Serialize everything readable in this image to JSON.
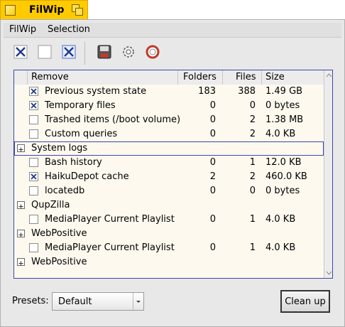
{
  "window": {
    "title": "FilWip"
  },
  "menu": [
    "FilWip",
    "Selection"
  ],
  "toolbar": {
    "icons": [
      "check-all-icon",
      "uncheck-all-icon",
      "toggle-check-icon",
      "save-icon",
      "settings-icon",
      "help-icon"
    ]
  },
  "table": {
    "columns": [
      "Remove",
      "Folders",
      "Files",
      "Size"
    ],
    "rows": [
      {
        "kind": "item",
        "checked": true,
        "name": "Previous system state",
        "folders": "183",
        "files": "388",
        "size": "1.49 GB"
      },
      {
        "kind": "item",
        "checked": true,
        "name": "Temporary files",
        "folders": "0",
        "files": "0",
        "size": "0 bytes"
      },
      {
        "kind": "item",
        "checked": false,
        "name": "Trashed items (/boot volume)",
        "folders": "0",
        "files": "2",
        "size": "1.38 MB"
      },
      {
        "kind": "item",
        "checked": false,
        "name": "Custom queries",
        "folders": "0",
        "files": "2",
        "size": "4.0 KB"
      },
      {
        "kind": "group",
        "name": "System logs"
      },
      {
        "kind": "item",
        "checked": false,
        "name": "Bash history",
        "folders": "0",
        "files": "1",
        "size": "12.0 KB"
      },
      {
        "kind": "item",
        "checked": true,
        "name": "HaikuDepot cache",
        "folders": "2",
        "files": "2",
        "size": "460.0 KB"
      },
      {
        "kind": "item",
        "checked": false,
        "name": "locatedb",
        "folders": "0",
        "files": "0",
        "size": "0 bytes"
      },
      {
        "kind": "group",
        "name": "QupZilla"
      },
      {
        "kind": "item",
        "checked": false,
        "name": "MediaPlayer Current Playlist",
        "folders": "0",
        "files": "1",
        "size": "4.0 KB"
      },
      {
        "kind": "group",
        "name": "WebPositive"
      },
      {
        "kind": "item",
        "checked": false,
        "name": "MediaPlayer Current Playlist",
        "folders": "0",
        "files": "1",
        "size": "4.0 KB"
      },
      {
        "kind": "group",
        "name": "WebPositive"
      }
    ]
  },
  "presets": {
    "label": "Presets:",
    "value": "Default"
  },
  "cleanup": {
    "label": "Clean up"
  },
  "colors": {
    "tab": "#ffcb00",
    "selection": "#3b4aa8",
    "checkmark": "#1f3a8a"
  }
}
